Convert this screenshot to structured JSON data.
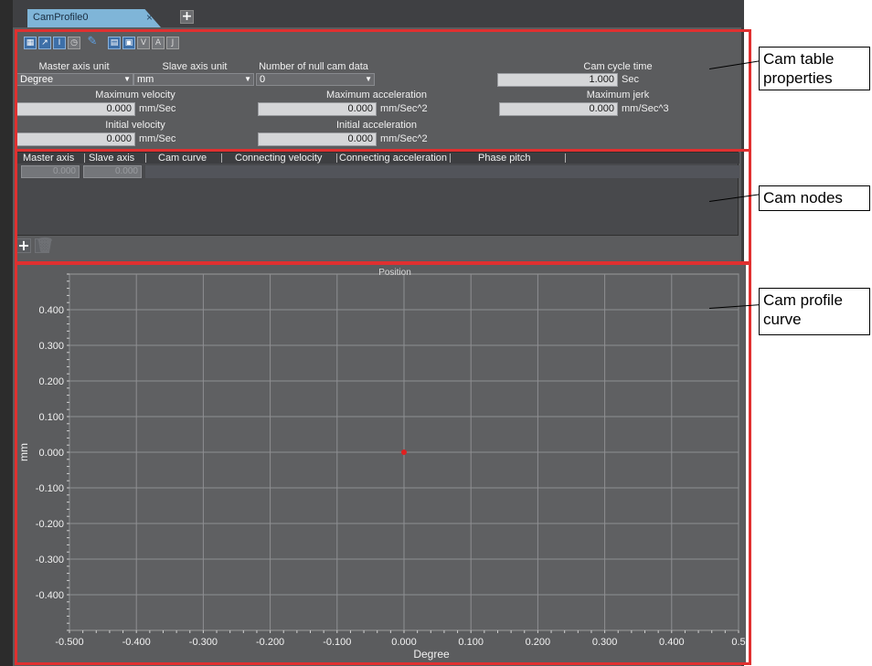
{
  "tab": {
    "title": "CamProfile0",
    "close_glyph": "×",
    "add_glyph": "+"
  },
  "toolbar": {
    "icons": [
      "grid-icon",
      "curve-icon",
      "cursor-icon",
      "clock-icon",
      "pen-icon",
      "table-icon",
      "table-edit-icon",
      "v-icon",
      "a-icon",
      "j-icon"
    ],
    "letters": {
      "v": "V",
      "a": "A",
      "j": "J"
    }
  },
  "properties": {
    "master_axis_unit_label": "Master axis unit",
    "master_axis_unit_value": "Degree",
    "slave_axis_unit_label": "Slave axis unit",
    "slave_axis_unit_value": "mm",
    "null_cam_label": "Number of null cam data",
    "null_cam_value": "0",
    "cam_cycle_time_label": "Cam cycle time",
    "cam_cycle_time_value": "1.000",
    "cam_cycle_time_unit": "Sec",
    "max_velocity_label": "Maximum velocity",
    "max_velocity_value": "0.000",
    "max_velocity_unit": "mm/Sec",
    "max_acceleration_label": "Maximum acceleration",
    "max_acceleration_value": "0.000",
    "max_acceleration_unit": "mm/Sec^2",
    "max_jerk_label": "Maximum jerk",
    "max_jerk_value": "0.000",
    "max_jerk_unit": "mm/Sec^3",
    "initial_velocity_label": "Initial velocity",
    "initial_velocity_value": "0.000",
    "initial_velocity_unit": "mm/Sec",
    "initial_acceleration_label": "Initial acceleration",
    "initial_acceleration_value": "0.000",
    "initial_acceleration_unit": "mm/Sec^2"
  },
  "nodes_table": {
    "columns": [
      "Master axis",
      "Slave axis",
      "Cam curve",
      "Connecting velocity",
      "Connecting acceleration",
      "Phase pitch"
    ],
    "rows": [
      {
        "master": "0.000",
        "slave": "0.000"
      }
    ],
    "add_glyph": "+",
    "delete_glyph": "🗑"
  },
  "chart_data": {
    "type": "scatter",
    "title": "Position",
    "xlabel": "Degree",
    "ylabel": "mm",
    "xlim": [
      -0.5,
      0.5
    ],
    "ylim": [
      -0.5,
      0.5
    ],
    "x_ticks": [
      "-0.500",
      "-0.400",
      "-0.300",
      "-0.200",
      "-0.100",
      "0.000",
      "0.100",
      "0.200",
      "0.300",
      "0.400",
      "0.5"
    ],
    "y_ticks": [
      "0.400",
      "0.300",
      "0.200",
      "0.100",
      "0.000",
      "-0.100",
      "-0.200",
      "-0.300",
      "-0.400"
    ],
    "y_ticks_values": [
      0.4,
      0.3,
      0.2,
      0.1,
      0.0,
      -0.1,
      -0.2,
      -0.3,
      -0.4
    ],
    "x_tick_values": [
      -0.5,
      -0.4,
      -0.3,
      -0.2,
      -0.1,
      0.0,
      0.1,
      0.2,
      0.3,
      0.4,
      0.5
    ],
    "points": [
      {
        "x": 0.0,
        "y": 0.0
      }
    ],
    "grid": true,
    "point_color": "#e02020"
  },
  "callouts": {
    "properties": "Cam table properties",
    "nodes": "Cam nodes",
    "curve": "Cam profile curve"
  },
  "colors": {
    "highlight": "#e03030",
    "tab": "#7fb5d8",
    "panel": "#5b5c5e"
  }
}
